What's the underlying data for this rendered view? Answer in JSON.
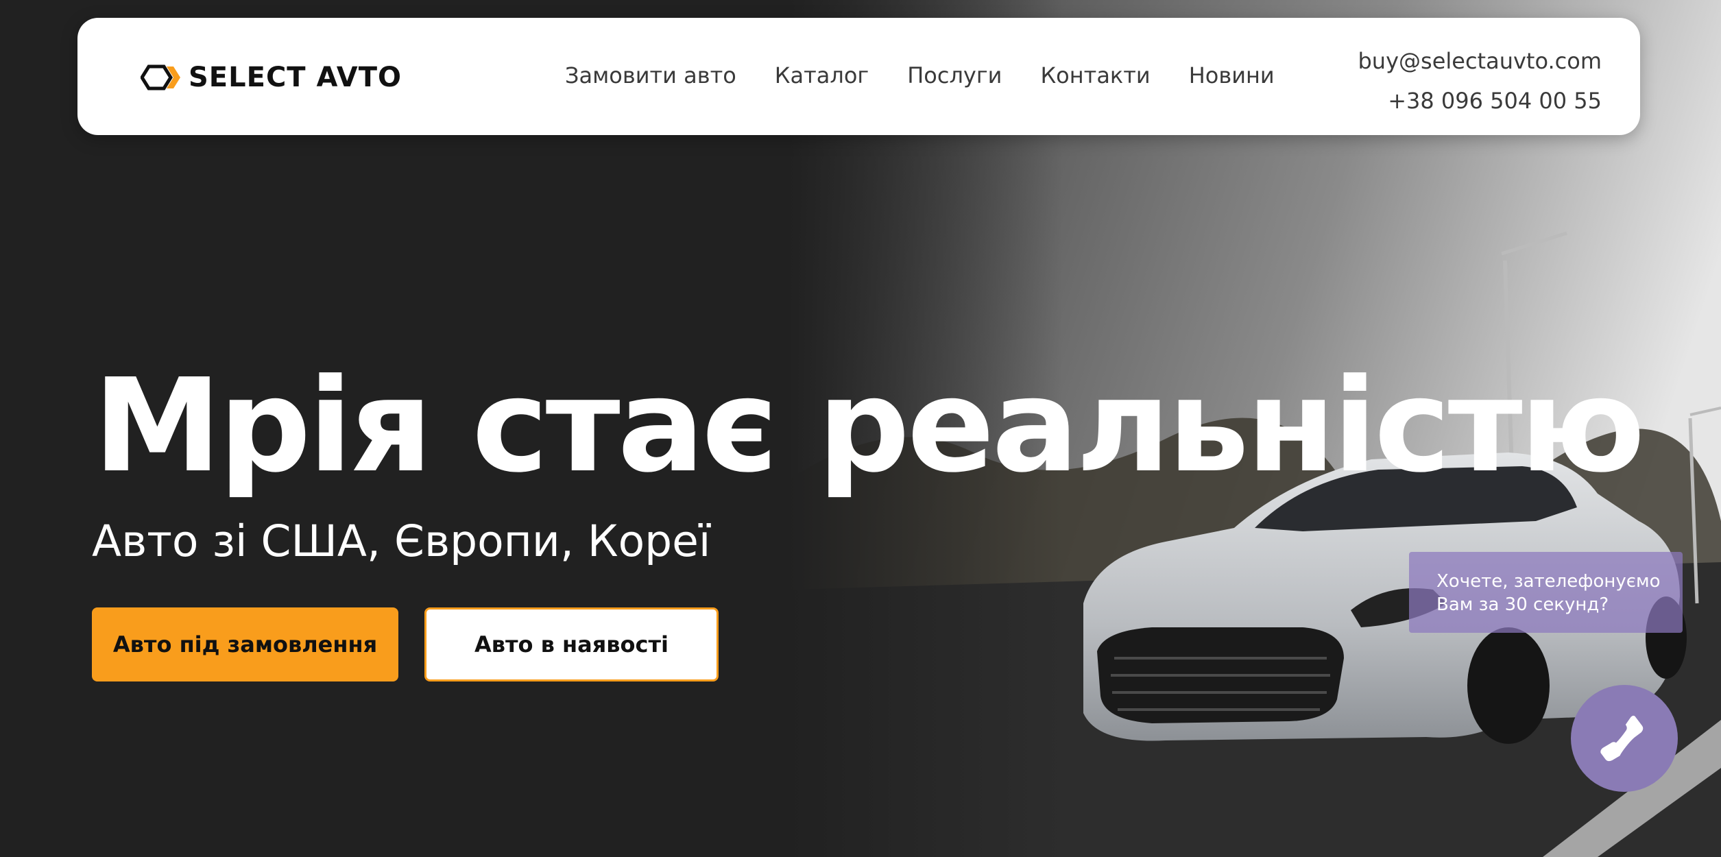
{
  "brand": {
    "name": "SELECT AVTO"
  },
  "nav": {
    "items": [
      {
        "label": "Замовити авто"
      },
      {
        "label": "Каталог"
      },
      {
        "label": "Послуги"
      },
      {
        "label": "Контакти"
      },
      {
        "label": "Новини"
      }
    ]
  },
  "contacts": {
    "email": "buy@selectauvto.com",
    "phone": "+38 096 504 00 55"
  },
  "hero": {
    "title": "Мрія стає реальністю",
    "subtitle": "Авто зі США, Європи, Кореї",
    "primary_button": "Авто під замовлення",
    "secondary_button": "Авто в наявості"
  },
  "callback": {
    "line1": "Хочете, зателефонуємо",
    "line2": "Вам за 30 секунд?",
    "icon": "phone-icon"
  },
  "colors": {
    "accent": "#f99d1c",
    "background": "#212121",
    "callback": "#8a7bb5"
  }
}
